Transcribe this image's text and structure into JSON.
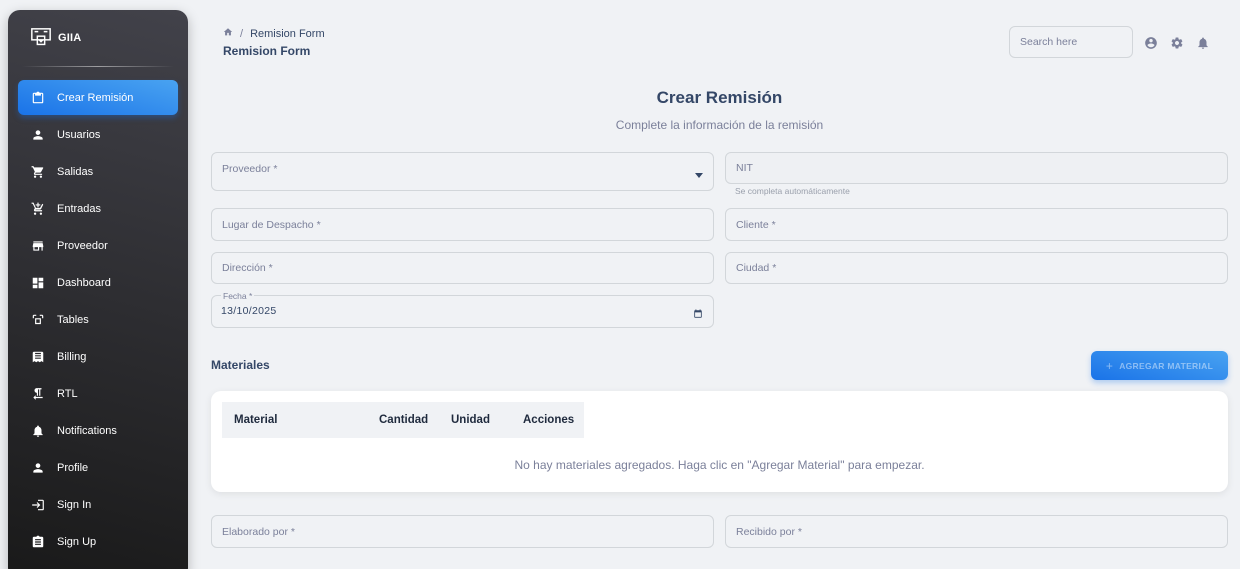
{
  "brand": {
    "name": "GIIA"
  },
  "sidebar": {
    "items": [
      {
        "label": "Crear Remisión",
        "icon": "clipboard-icon",
        "active": true
      },
      {
        "label": "Usuarios",
        "icon": "person-icon"
      },
      {
        "label": "Salidas",
        "icon": "cart-icon"
      },
      {
        "label": "Entradas",
        "icon": "add-cart-icon"
      },
      {
        "label": "Proveedor",
        "icon": "store-icon"
      },
      {
        "label": "Dashboard",
        "icon": "dashboard-icon"
      },
      {
        "label": "Tables",
        "icon": "table-icon"
      },
      {
        "label": "Billing",
        "icon": "receipt-icon"
      },
      {
        "label": "RTL",
        "icon": "format-textdirection-icon"
      },
      {
        "label": "Notifications",
        "icon": "bell-icon"
      },
      {
        "label": "Profile",
        "icon": "person-icon"
      },
      {
        "label": "Sign In",
        "icon": "login-icon"
      },
      {
        "label": "Sign Up",
        "icon": "assignment-icon"
      }
    ]
  },
  "header": {
    "breadcrumb_current": "Remision Form",
    "title": "Remision Form",
    "search_placeholder": "Search here"
  },
  "form": {
    "title": "Crear Remisión",
    "subtitle": "Complete la información de la remisión",
    "proveedor_label": "Proveedor *",
    "nit_label": "NIT",
    "nit_helper": "Se completa automáticamente",
    "lugar_label": "Lugar de Despacho *",
    "cliente_label": "Cliente *",
    "direccion_label": "Dirección *",
    "ciudad_label": "Ciudad *",
    "fecha_label": "Fecha *",
    "fecha_value": "13/10/2025",
    "elaborado_label": "Elaborado por *",
    "recibido_label": "Recibido por *"
  },
  "materiales": {
    "title": "Materiales",
    "add_button": "AGREGAR MATERIAL",
    "columns": [
      "Material",
      "Cantidad",
      "Unidad",
      "Acciones"
    ],
    "empty_message": "No hay materiales agregados. Haga clic en \"Agregar Material\" para empezar."
  }
}
